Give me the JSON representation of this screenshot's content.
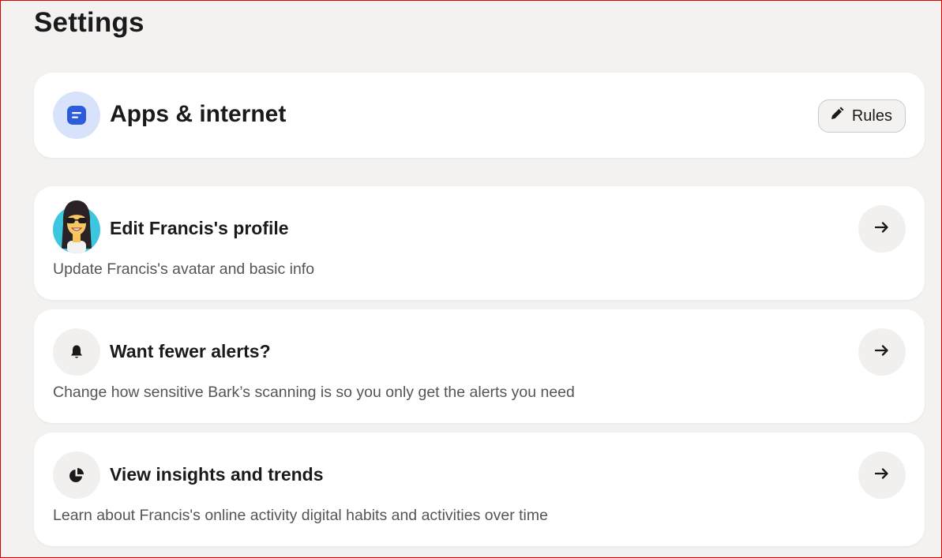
{
  "page": {
    "title": "Settings"
  },
  "apps_card": {
    "title": "Apps & internet",
    "icon": "document-icon",
    "rules_button": {
      "label": "Rules",
      "icon": "pencil-icon"
    }
  },
  "rows": [
    {
      "title": "Edit Francis's profile",
      "description": "Update Francis's avatar and basic info",
      "icon": "avatar",
      "action_icon": "arrow-right-icon"
    },
    {
      "title": "Want fewer alerts?",
      "description": "Change how sensitive Bark’s scanning is so you only get the alerts you need",
      "icon": "bell-icon",
      "action_icon": "arrow-right-icon"
    },
    {
      "title": "View insights and trends",
      "description": "Learn about Francis's online activity digital habits and activities over time",
      "icon": "pie-chart-icon",
      "action_icon": "arrow-right-icon"
    }
  ],
  "colors": {
    "background": "#f3f2f1",
    "card": "#ffffff",
    "apps_icon_bg": "#d8e3fb",
    "apps_icon": "#2d5bd9",
    "frame_border": "#e00000"
  }
}
